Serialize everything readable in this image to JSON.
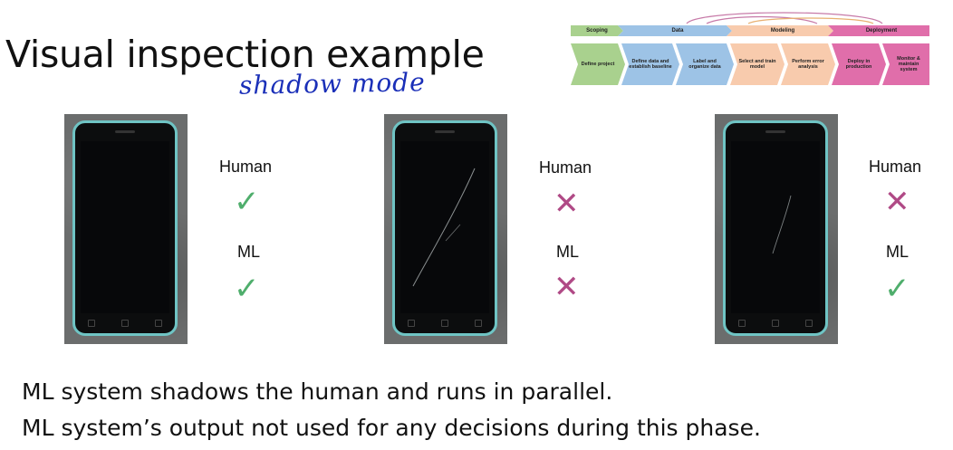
{
  "title": "Visual inspection example",
  "annotation": "shadow mode",
  "lifecycle": {
    "phases": [
      "Scoping",
      "Data",
      "Modeling",
      "Deployment"
    ],
    "steps": [
      "Define project",
      "Define data and establish baseline",
      "Label and organize data",
      "Select and train model",
      "Perform error analysis",
      "Deploy in production",
      "Monitor & maintain system"
    ]
  },
  "examples": [
    {
      "human_label": "Human",
      "human_mark": "✓",
      "ml_label": "ML",
      "ml_mark": "✓"
    },
    {
      "human_label": "Human",
      "human_mark": "✕",
      "ml_label": "ML",
      "ml_mark": "✕"
    },
    {
      "human_label": "Human",
      "human_mark": "✕",
      "ml_label": "ML",
      "ml_mark": "✓"
    }
  ],
  "footer": {
    "line1": "ML system shadows the human and runs in parallel.",
    "line2": "ML system’s output not used for any decisions during this phase."
  },
  "colors": {
    "check": "#4fae6c",
    "cross": "#b04a86",
    "phone_border": "#6fc4c4",
    "annotation": "#1a2fb8"
  }
}
